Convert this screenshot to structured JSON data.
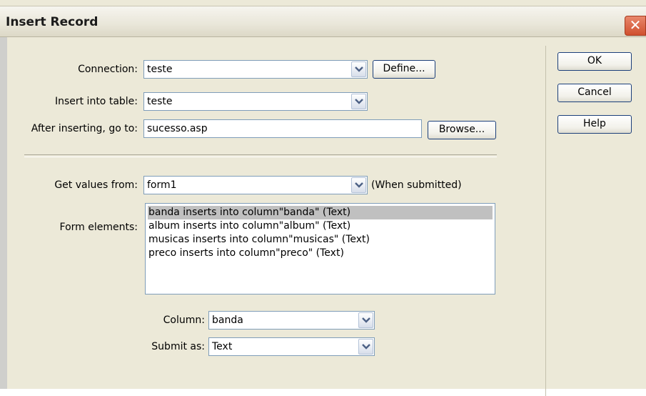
{
  "dialog": {
    "title": "Insert Record",
    "close_symbol": "✕"
  },
  "form": {
    "connection": {
      "label": "Connection:",
      "value": "teste",
      "define_button": "Define..."
    },
    "insert_table": {
      "label": "Insert into table:",
      "value": "teste"
    },
    "after_insert": {
      "label": "After inserting, go to:",
      "value": "sucesso.asp",
      "browse_button": "Browse..."
    },
    "get_values": {
      "label": "Get values from:",
      "value": "form1",
      "note": "(When submitted)"
    },
    "form_elements": {
      "label": "Form elements:",
      "items": [
        "banda inserts into column\"banda\" (Text)",
        "album inserts into column\"album\" (Text)",
        "musicas inserts into column\"musicas\" (Text)",
        "preco inserts into column\"preco\" (Text)"
      ],
      "selected_index": 0
    },
    "column": {
      "label": "Column:",
      "value": "banda"
    },
    "submit_as": {
      "label": "Submit as:",
      "value": "Text"
    }
  },
  "buttons": {
    "ok": "OK",
    "cancel": "Cancel",
    "help": "Help"
  },
  "icons": {
    "dropdown": "chevron-down-icon",
    "close": "close-icon"
  }
}
